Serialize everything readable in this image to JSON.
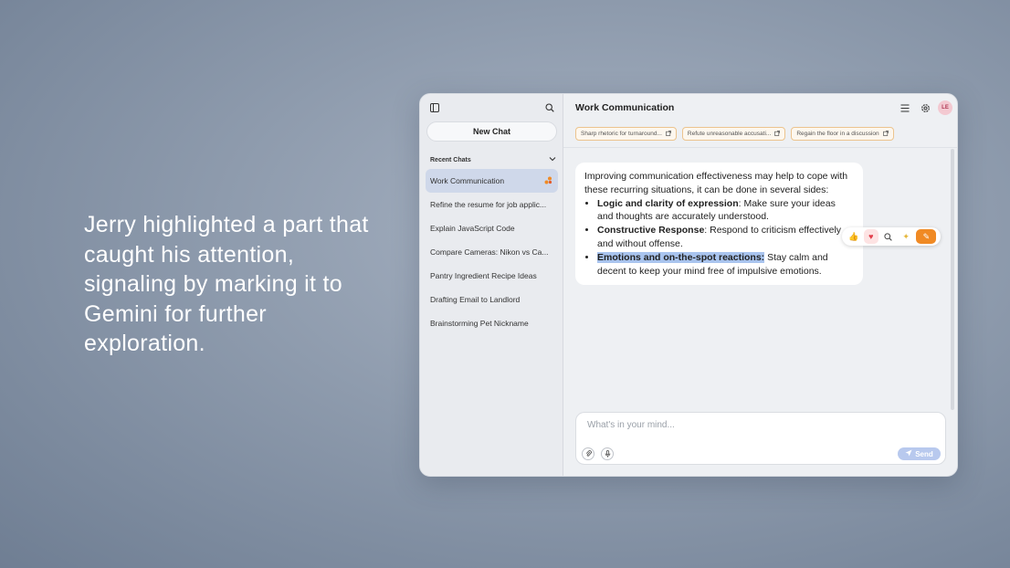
{
  "caption": "Jerry highlighted a part that caught his attention, signaling by marking it to Gemini for further exploration.",
  "sidebar": {
    "new_chat": "New Chat",
    "section_title": "Recent Chats",
    "items": [
      {
        "label": "Work Communication"
      },
      {
        "label": "Refine the resume for job applic..."
      },
      {
        "label": "Explain JavaScript Code"
      },
      {
        "label": "Compare Cameras: Nikon vs Ca..."
      },
      {
        "label": "Pantry Ingredient Recipe Ideas"
      },
      {
        "label": "Drafting Email to Landlord"
      },
      {
        "label": "Brainstorming Pet Nickname"
      }
    ]
  },
  "header": {
    "title": "Work Communication",
    "avatar": "LE"
  },
  "chips": [
    {
      "label": "Sharp rhetoric for turnaround..."
    },
    {
      "label": "Refute unreasonable accusati..."
    },
    {
      "label": "Regain the floor in a discussion"
    }
  ],
  "message": {
    "intro": "Improving communication effectiveness may help to cope with these recurring situations, it can be done in several sides:",
    "b1_bold": "Logic and clarity of expression",
    "b1_rest": ": Make sure your ideas and thoughts are accurately understood.",
    "b2_bold": "Constructive Response",
    "b2_rest": ": Respond to criticism effectively and without offense.",
    "b3_bold": "Emotions and on-the-spot reactions:",
    "b3_rest": " Stay calm and decent to keep your mind free of impulsive  emotions."
  },
  "composer": {
    "placeholder": "What's in your mind...",
    "send_label": "Send"
  },
  "colors": {
    "accent": "#f08a24",
    "selection": "#a9c4ee",
    "active_item": "#cfd8ea"
  }
}
